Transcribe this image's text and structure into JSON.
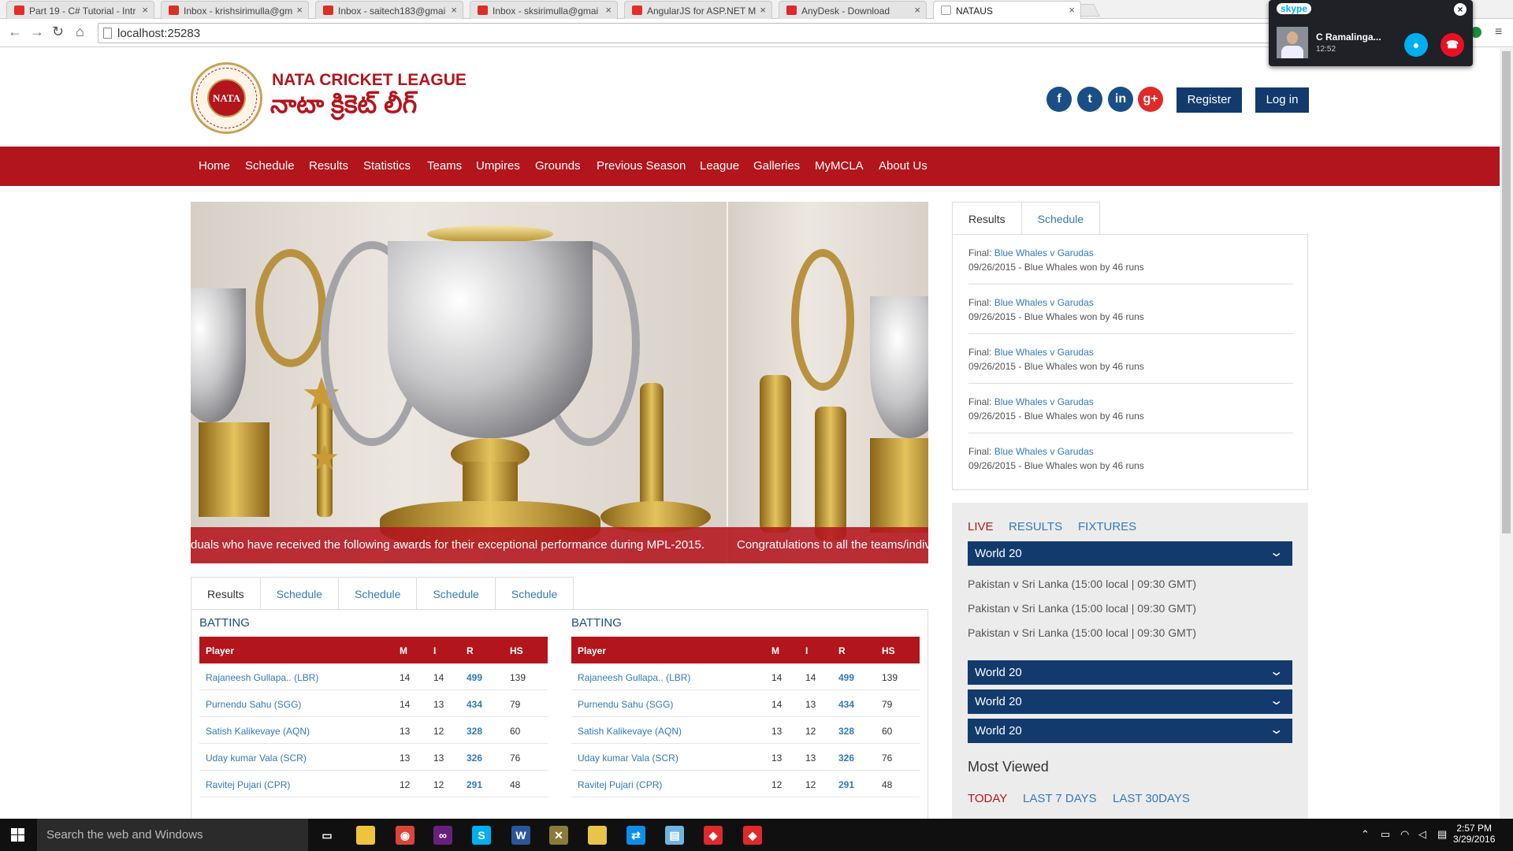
{
  "browser": {
    "tabs": [
      {
        "title": "Part 19 - C# Tutorial - Intr",
        "icon": "youtube-icon",
        "color": "#e52d27"
      },
      {
        "title": "Inbox - krishsirimulla@gm",
        "icon": "gmail-icon",
        "color": "#d93025"
      },
      {
        "title": "Inbox - saitech183@gmai",
        "icon": "gmail-icon",
        "color": "#d93025"
      },
      {
        "title": "Inbox - sksirimulla@gmai",
        "icon": "gmail-icon",
        "color": "#d93025"
      },
      {
        "title": "AngularJS for ASP.NET M",
        "icon": "youtube-icon",
        "color": "#e52d27"
      },
      {
        "title": "AnyDesk - Download",
        "icon": "anydesk-icon",
        "color": "#e0282d"
      },
      {
        "title": "NATAUS",
        "icon": "page-icon",
        "color": "#ffffff"
      }
    ],
    "url": "localhost:25283"
  },
  "skype": {
    "logo": "skype",
    "caller": "C Ramalinga...",
    "time": "12:52"
  },
  "header": {
    "logo_text": "NATA",
    "title": "NATA CRICKET LEAGUE",
    "subtitle": "నాటా క్రికెట్ లీగ్",
    "social": [
      {
        "icon": "facebook-icon",
        "glyph": "f",
        "color": "#1a4e86"
      },
      {
        "icon": "twitter-icon",
        "glyph": "t",
        "color": "#1a4e86"
      },
      {
        "icon": "linkedin-icon",
        "glyph": "in",
        "color": "#1a4e86"
      },
      {
        "icon": "google-plus-icon",
        "glyph": "g+",
        "color": "#e02a2a"
      }
    ],
    "register_label": "Register",
    "login_label": "Log in"
  },
  "nav": [
    "Home",
    "Schedule",
    "Results",
    "Statistics",
    "Teams",
    "Umpires",
    "Grounds",
    "Previous Season",
    "League",
    "Galleries",
    "MyMCLA",
    "About Us"
  ],
  "hero": {
    "caption_left": "duals who have received the following awards for their exceptional performance during MPL-2015.",
    "caption_right": "Congratulations to all the teams/indivi"
  },
  "stats_tabs": [
    "Results",
    "Schedule",
    "Schedule",
    "Schedule",
    "Schedule"
  ],
  "batting": {
    "title": "BATTING",
    "headers": [
      "Player",
      "M",
      "I",
      "R",
      "HS"
    ],
    "rows": [
      {
        "player": "Rajaneesh Gullapa.. (LBR)",
        "m": "14",
        "i": "14",
        "r": "499",
        "hs": "139"
      },
      {
        "player": "Purnendu Sahu (SGG)",
        "m": "14",
        "i": "13",
        "r": "434",
        "hs": "79"
      },
      {
        "player": "Satish Kalikevaye (AQN)",
        "m": "13",
        "i": "12",
        "r": "328",
        "hs": "60"
      },
      {
        "player": "Uday kumar Vala (SCR)",
        "m": "13",
        "i": "13",
        "r": "326",
        "hs": "76"
      },
      {
        "player": "Ravitej Pujari (CPR)",
        "m": "12",
        "i": "12",
        "r": "291",
        "hs": "48"
      }
    ]
  },
  "side_tabs": [
    "Results",
    "Schedule"
  ],
  "results": [
    {
      "prefix": "Final: ",
      "match": "Blue Whales v Garudas",
      "detail": "09/26/2015 - Blue Whales won by 46 runs"
    },
    {
      "prefix": "Final: ",
      "match": "Blue Whales v Garudas",
      "detail": "09/26/2015 - Blue Whales won by 46 runs"
    },
    {
      "prefix": "Final: ",
      "match": "Blue Whales v Garudas",
      "detail": "09/26/2015 - Blue Whales won by 46 runs"
    },
    {
      "prefix": "Final: ",
      "match": "Blue Whales v Garudas",
      "detail": "09/26/2015 - Blue Whales won by 46 runs"
    },
    {
      "prefix": "Final: ",
      "match": "Blue Whales v Garudas",
      "detail": "09/26/2015 - Blue Whales won by 46 runs"
    }
  ],
  "live": {
    "tabs": [
      "LIVE",
      "RESULTS",
      "FIXTURES"
    ],
    "groups": [
      "World 20",
      "World 20",
      "World 20",
      "World 20"
    ],
    "fixtures": [
      "Pakistan v Sri Lanka (15:00 local | 09:30 GMT)",
      "Pakistan v Sri Lanka (15:00 local | 09:30 GMT)",
      "Pakistan v Sri Lanka (15:00 local | 09:30 GMT)"
    ]
  },
  "most_viewed": {
    "title": "Most Viewed",
    "tabs": [
      "TODAY",
      "LAST 7 DAYS",
      "LAST 30DAYS"
    ]
  },
  "taskbar": {
    "search_placeholder": "Search the web and Windows",
    "apps": [
      {
        "icon": "task-view-icon",
        "color": "#101010",
        "glyph": "▭"
      },
      {
        "icon": "file-explorer-icon",
        "color": "#f0c33c",
        "glyph": ""
      },
      {
        "icon": "chrome-icon",
        "color": "#db4437",
        "glyph": "◉"
      },
      {
        "icon": "visual-studio-icon",
        "color": "#68217a",
        "glyph": "∞"
      },
      {
        "icon": "skype-icon",
        "color": "#00aff0",
        "glyph": "S"
      },
      {
        "icon": "word-icon",
        "color": "#2b579a",
        "glyph": "W"
      },
      {
        "icon": "tools-icon",
        "color": "#8b7a3a",
        "glyph": "✕"
      },
      {
        "icon": "folder-icon",
        "color": "#e8c547",
        "glyph": ""
      },
      {
        "icon": "teamviewer-icon",
        "color": "#0e8ee9",
        "glyph": "⇄"
      },
      {
        "icon": "notepad-icon",
        "color": "#6fb5e0",
        "glyph": "▤"
      },
      {
        "icon": "anydesk-icon",
        "color": "#e0282d",
        "glyph": "◆"
      },
      {
        "icon": "anydesk-icon",
        "color": "#e0282d",
        "glyph": "◆"
      }
    ],
    "time": "2:57 PM",
    "date": "3/29/2016"
  }
}
